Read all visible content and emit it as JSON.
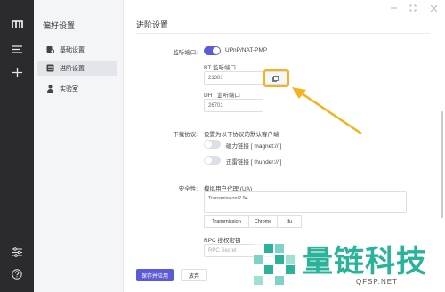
{
  "sidebar": {
    "title": "偏好设置",
    "items": [
      {
        "label": "基础设置",
        "icon": "gear-person-icon"
      },
      {
        "label": "进阶设置",
        "icon": "advanced-settings-icon"
      },
      {
        "label": "实验室",
        "icon": "person-icon"
      }
    ]
  },
  "main": {
    "title": "进阶设置",
    "listen_port": {
      "label": "监听端口:",
      "upnp_label": "UPnP/NAT-PMP",
      "upnp_enabled": true,
      "bt_label": "BT 监听端口",
      "bt_value": "21301",
      "dht_label": "DHT 监听端口",
      "dht_value": "26701"
    },
    "protocols": {
      "label": "下载协议:",
      "description": "设置为以下协议的默认客户端",
      "magnet_label": "磁力链接 [ magnet:// ]",
      "magnet_enabled": false,
      "thunder_label": "迅雷链接 [ thunder:// ]",
      "thunder_enabled": false
    },
    "security": {
      "label": "安全性:",
      "ua_label": "模拟用户代理 (UA)",
      "ua_value": "Transmission/2.94",
      "ua_buttons": [
        "Transmission",
        "Chrome",
        "du"
      ],
      "rpc_label": "RPC 授权密钥",
      "rpc_placeholder": "RPC Secret"
    },
    "save_label": "保存并应用",
    "cancel_label": "放弃"
  },
  "watermark": {
    "text": "量链科技",
    "url": "QFSP.NET"
  },
  "colors": {
    "accent": "#5b5bd6",
    "rail": "#2b2b2e",
    "annotation": "#f5b21b",
    "watermark": "#2bb39a"
  }
}
